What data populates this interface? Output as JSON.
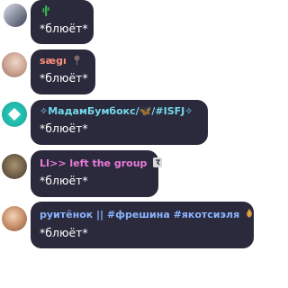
{
  "messages": [
    {
      "name": "",
      "name_icon": "cactus-icon",
      "text": "*блюёт*",
      "name_color": "#4fcf6d"
    },
    {
      "name": "sægı",
      "name_icon": "rose-icon",
      "text": "*блюёт*",
      "name_color": "#ff8f7a"
    },
    {
      "name": "✧МадамБумбокс/🦋/#ISFJ✧",
      "name_icon": "",
      "text": "*блюёт*",
      "name_color": "#74d9ea"
    },
    {
      "name": "LI>> left the group",
      "name_icon": "broken-heart-icon",
      "text": "*блюёт*",
      "name_color": "#e97bd8"
    },
    {
      "name": "руитёнок || #фрешина #якотсиэля",
      "name_icon": "fire-icon",
      "text": "*блюёт*",
      "name_color": "#8ab4ff"
    }
  ]
}
